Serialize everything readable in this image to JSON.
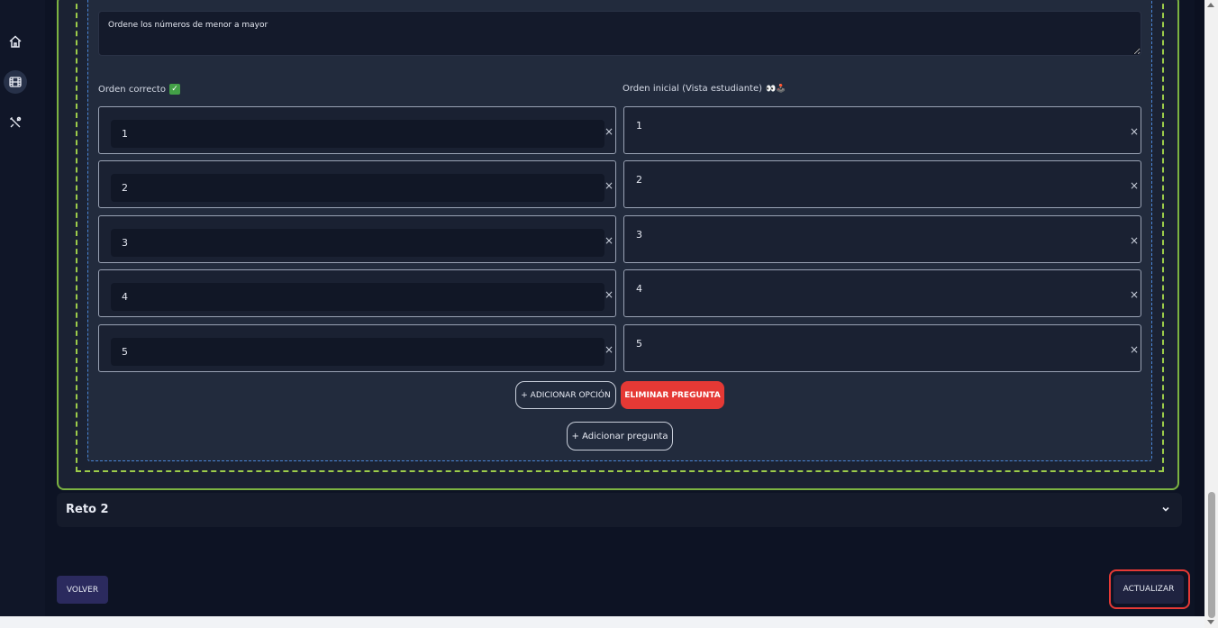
{
  "sidebar": {
    "items": [
      {
        "icon": "home-icon"
      },
      {
        "icon": "film-icon",
        "active": true
      },
      {
        "icon": "tools-icon"
      }
    ]
  },
  "question": {
    "statement": "Ordene los números de menor a mayor",
    "correct_label": "Orden correcto",
    "correct_emoji": "✅",
    "initial_label": "Orden inicial (Vista estudiante)",
    "initial_emojis": "👀🕹️",
    "correct_order": [
      "1",
      "2",
      "3",
      "4",
      "5"
    ],
    "initial_order": [
      "1",
      "2",
      "3",
      "4",
      "5"
    ],
    "remove_symbol": "×",
    "add_option": "+ ADICIONAR OPCIÓN",
    "delete_question": "ELIMINAR PREGUNTA"
  },
  "add_question": "+ Adicionar pregunta",
  "reto2": {
    "title": "Reto 2"
  },
  "footer": {
    "back": "VOLVER",
    "update": "ACTUALIZAR"
  },
  "colors": {
    "accent_green": "#7cb342",
    "danger": "#e53935",
    "dash_blue": "#4a86d8"
  }
}
